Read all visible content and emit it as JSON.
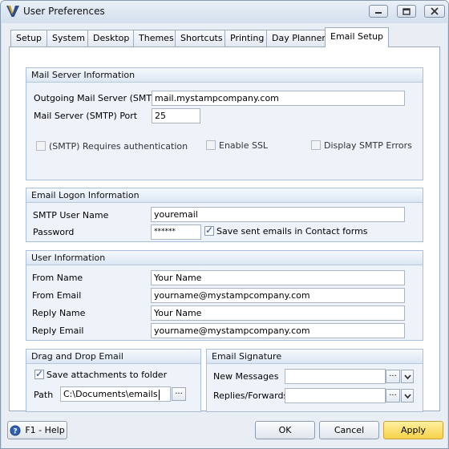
{
  "window": {
    "title": "User Preferences"
  },
  "tabs": [
    "Setup",
    "System",
    "Desktop",
    "Themes",
    "Shortcuts",
    "Printing",
    "Day Planner",
    "Email Setup"
  ],
  "mail_server": {
    "header": "Mail Server Information",
    "smtp_label": "Outgoing Mail Server (SMTP)",
    "smtp_value": "mail.mystampcompany.com",
    "port_label": "Mail Server (SMTP) Port",
    "port_value": "25",
    "requires_auth_label": "(SMTP) Requires authentication",
    "enable_ssl_label": "Enable SSL",
    "display_errors_label": "Display SMTP Errors"
  },
  "logon": {
    "header": "Email Logon Information",
    "user_label": "SMTP User Name",
    "user_value": "youremail",
    "password_label": "Password",
    "password_value": "******",
    "save_sent_label": "Save sent emails in Contact forms"
  },
  "user_info": {
    "header": "User Information",
    "from_name_label": "From Name",
    "from_name_value": "Your Name",
    "from_email_label": "From Email",
    "from_email_value": "yourname@mystampcompany.com",
    "reply_name_label": "Reply Name",
    "reply_name_value": "Your Name",
    "reply_email_label": "Reply Email",
    "reply_email_value": "yourname@mystampcompany.com"
  },
  "drag_drop": {
    "header": "Drag and Drop Email",
    "save_attach_label": "Save attachments to folder",
    "path_label": "Path",
    "path_value": "C:\\Documents\\emails"
  },
  "signature": {
    "header": "Email Signature",
    "new_messages_label": "New Messages",
    "replies_label": "Replies/Forwards"
  },
  "buttons": {
    "help": "F1 - Help",
    "ok": "OK",
    "cancel": "Cancel",
    "apply": "Apply"
  },
  "icons": {
    "app": "v-logo-icon",
    "help": "help-icon",
    "browse": "ellipsis-icon",
    "dropdown": "chevron-down-icon"
  }
}
